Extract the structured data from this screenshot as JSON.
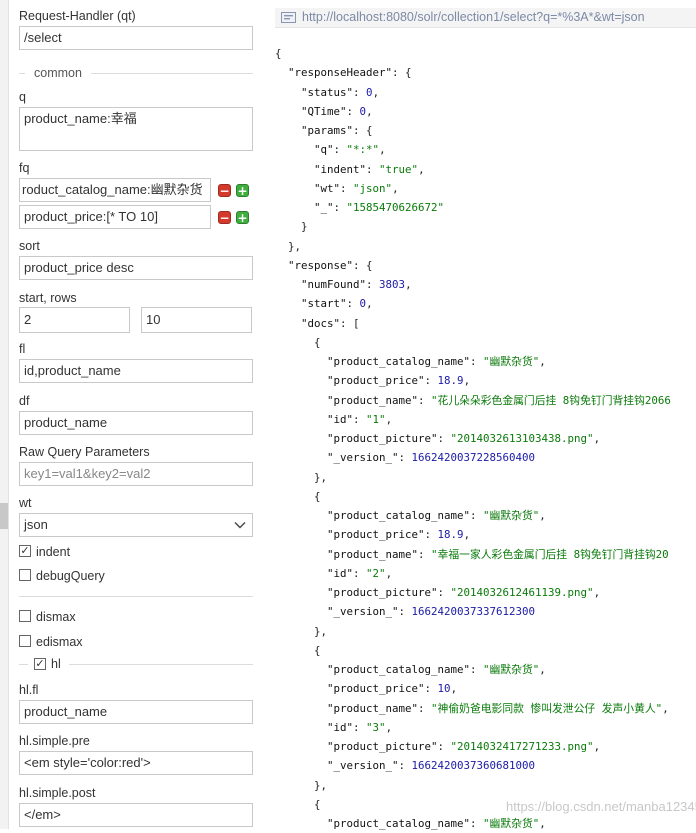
{
  "form": {
    "request_handler_label": "Request-Handler (qt)",
    "request_handler_value": "/select",
    "common_section": "common",
    "q_label": "q",
    "q_value": "product_name:幸福",
    "fq_label": "fq",
    "fq_values": [
      "roduct_catalog_name:幽默杂货",
      "product_price:[* TO 10]"
    ],
    "sort_label": "sort",
    "sort_value": "product_price desc",
    "start_rows_label": "start, rows",
    "start_value": "2",
    "rows_value": "10",
    "fl_label": "fl",
    "fl_value": "id,product_name",
    "df_label": "df",
    "df_value": "product_name",
    "raw_label": "Raw Query Parameters",
    "raw_placeholder": "key1=val1&key2=val2",
    "wt_label": "wt",
    "wt_value": "json",
    "indent_label": "indent",
    "debug_label": "debugQuery",
    "dismax_label": "dismax",
    "edismax_label": "edismax",
    "hl_label": "hl",
    "hl_fl_label": "hl.fl",
    "hl_fl_value": "product_name",
    "hl_pre_label": "hl.simple.pre",
    "hl_pre_value": "<em style='color:red'>",
    "hl_post_label": "hl.simple.post",
    "hl_post_value": "</em>",
    "add_icon": "plus-icon",
    "remove_icon": "minus-icon"
  },
  "result": {
    "url": "http://localhost:8080/solr/collection1/select?q=*%3A*&wt=json",
    "json_lines": [
      [
        [
          "p",
          "{"
        ]
      ],
      [
        [
          "p",
          "  "
        ],
        [
          "k",
          "\"responseHeader\""
        ],
        [
          "p",
          ": {"
        ]
      ],
      [
        [
          "p",
          "    "
        ],
        [
          "k",
          "\"status\""
        ],
        [
          "p",
          ": "
        ],
        [
          "n",
          "0"
        ],
        [
          "p",
          ","
        ]
      ],
      [
        [
          "p",
          "    "
        ],
        [
          "k",
          "\"QTime\""
        ],
        [
          "p",
          ": "
        ],
        [
          "n",
          "0"
        ],
        [
          "p",
          ","
        ]
      ],
      [
        [
          "p",
          "    "
        ],
        [
          "k",
          "\"params\""
        ],
        [
          "p",
          ": {"
        ]
      ],
      [
        [
          "p",
          "      "
        ],
        [
          "k",
          "\"q\""
        ],
        [
          "p",
          ": "
        ],
        [
          "s",
          "\"*:*\""
        ],
        [
          "p",
          ","
        ]
      ],
      [
        [
          "p",
          "      "
        ],
        [
          "k",
          "\"indent\""
        ],
        [
          "p",
          ": "
        ],
        [
          "s",
          "\"true\""
        ],
        [
          "p",
          ","
        ]
      ],
      [
        [
          "p",
          "      "
        ],
        [
          "k",
          "\"wt\""
        ],
        [
          "p",
          ": "
        ],
        [
          "s",
          "\"json\""
        ],
        [
          "p",
          ","
        ]
      ],
      [
        [
          "p",
          "      "
        ],
        [
          "k",
          "\"_\""
        ],
        [
          "p",
          ": "
        ],
        [
          "s",
          "\"1585470626672\""
        ]
      ],
      [
        [
          "p",
          "    }"
        ]
      ],
      [
        [
          "p",
          "  },"
        ]
      ],
      [
        [
          "p",
          "  "
        ],
        [
          "k",
          "\"response\""
        ],
        [
          "p",
          ": {"
        ]
      ],
      [
        [
          "p",
          "    "
        ],
        [
          "k",
          "\"numFound\""
        ],
        [
          "p",
          ": "
        ],
        [
          "n",
          "3803"
        ],
        [
          "p",
          ","
        ]
      ],
      [
        [
          "p",
          "    "
        ],
        [
          "k",
          "\"start\""
        ],
        [
          "p",
          ": "
        ],
        [
          "n",
          "0"
        ],
        [
          "p",
          ","
        ]
      ],
      [
        [
          "p",
          "    "
        ],
        [
          "k",
          "\"docs\""
        ],
        [
          "p",
          ": ["
        ]
      ],
      [
        [
          "p",
          "      {"
        ]
      ],
      [
        [
          "p",
          "        "
        ],
        [
          "k",
          "\"product_catalog_name\""
        ],
        [
          "p",
          ": "
        ],
        [
          "s",
          "\"幽默杂货\""
        ],
        [
          "p",
          ","
        ]
      ],
      [
        [
          "p",
          "        "
        ],
        [
          "k",
          "\"product_price\""
        ],
        [
          "p",
          ": "
        ],
        [
          "n",
          "18.9"
        ],
        [
          "p",
          ","
        ]
      ],
      [
        [
          "p",
          "        "
        ],
        [
          "k",
          "\"product_name\""
        ],
        [
          "p",
          ": "
        ],
        [
          "s",
          "\"花儿朵朵彩色金属门后挂 8钩免钉门背挂钩2066"
        ]
      ],
      [
        [
          "p",
          "        "
        ],
        [
          "k",
          "\"id\""
        ],
        [
          "p",
          ": "
        ],
        [
          "s",
          "\"1\""
        ],
        [
          "p",
          ","
        ]
      ],
      [
        [
          "p",
          "        "
        ],
        [
          "k",
          "\"product_picture\""
        ],
        [
          "p",
          ": "
        ],
        [
          "s",
          "\"2014032613103438.png\""
        ],
        [
          "p",
          ","
        ]
      ],
      [
        [
          "p",
          "        "
        ],
        [
          "k",
          "\"_version_\""
        ],
        [
          "p",
          ": "
        ],
        [
          "n",
          "1662420037228560400"
        ]
      ],
      [
        [
          "p",
          "      },"
        ]
      ],
      [
        [
          "p",
          "      {"
        ]
      ],
      [
        [
          "p",
          "        "
        ],
        [
          "k",
          "\"product_catalog_name\""
        ],
        [
          "p",
          ": "
        ],
        [
          "s",
          "\"幽默杂货\""
        ],
        [
          "p",
          ","
        ]
      ],
      [
        [
          "p",
          "        "
        ],
        [
          "k",
          "\"product_price\""
        ],
        [
          "p",
          ": "
        ],
        [
          "n",
          "18.9"
        ],
        [
          "p",
          ","
        ]
      ],
      [
        [
          "p",
          "        "
        ],
        [
          "k",
          "\"product_name\""
        ],
        [
          "p",
          ": "
        ],
        [
          "s",
          "\"幸福一家人彩色金属门后挂 8钩免钉门背挂钩20"
        ]
      ],
      [
        [
          "p",
          "        "
        ],
        [
          "k",
          "\"id\""
        ],
        [
          "p",
          ": "
        ],
        [
          "s",
          "\"2\""
        ],
        [
          "p",
          ","
        ]
      ],
      [
        [
          "p",
          "        "
        ],
        [
          "k",
          "\"product_picture\""
        ],
        [
          "p",
          ": "
        ],
        [
          "s",
          "\"2014032612461139.png\""
        ],
        [
          "p",
          ","
        ]
      ],
      [
        [
          "p",
          "        "
        ],
        [
          "k",
          "\"_version_\""
        ],
        [
          "p",
          ": "
        ],
        [
          "n",
          "1662420037337612300"
        ]
      ],
      [
        [
          "p",
          "      },"
        ]
      ],
      [
        [
          "p",
          "      {"
        ]
      ],
      [
        [
          "p",
          "        "
        ],
        [
          "k",
          "\"product_catalog_name\""
        ],
        [
          "p",
          ": "
        ],
        [
          "s",
          "\"幽默杂货\""
        ],
        [
          "p",
          ","
        ]
      ],
      [
        [
          "p",
          "        "
        ],
        [
          "k",
          "\"product_price\""
        ],
        [
          "p",
          ": "
        ],
        [
          "n",
          "10"
        ],
        [
          "p",
          ","
        ]
      ],
      [
        [
          "p",
          "        "
        ],
        [
          "k",
          "\"product_name\""
        ],
        [
          "p",
          ": "
        ],
        [
          "s",
          "\"神偷奶爸电影同款 惨叫发泄公仔 发声小黄人\""
        ],
        [
          "p",
          ","
        ]
      ],
      [
        [
          "p",
          "        "
        ],
        [
          "k",
          "\"id\""
        ],
        [
          "p",
          ": "
        ],
        [
          "s",
          "\"3\""
        ],
        [
          "p",
          ","
        ]
      ],
      [
        [
          "p",
          "        "
        ],
        [
          "k",
          "\"product_picture\""
        ],
        [
          "p",
          ": "
        ],
        [
          "s",
          "\"2014032417271233.png\""
        ],
        [
          "p",
          ","
        ]
      ],
      [
        [
          "p",
          "        "
        ],
        [
          "k",
          "\"_version_\""
        ],
        [
          "p",
          ": "
        ],
        [
          "n",
          "1662420037360681000"
        ]
      ],
      [
        [
          "p",
          "      },"
        ]
      ],
      [
        [
          "p",
          "      {"
        ]
      ],
      [
        [
          "p",
          "        "
        ],
        [
          "k",
          "\"product_catalog_name\""
        ],
        [
          "p",
          ": "
        ],
        [
          "s",
          "\"幽默杂货\""
        ],
        [
          "p",
          ","
        ]
      ]
    ]
  },
  "watermark": "https://blog.csdn.net/manba123456"
}
